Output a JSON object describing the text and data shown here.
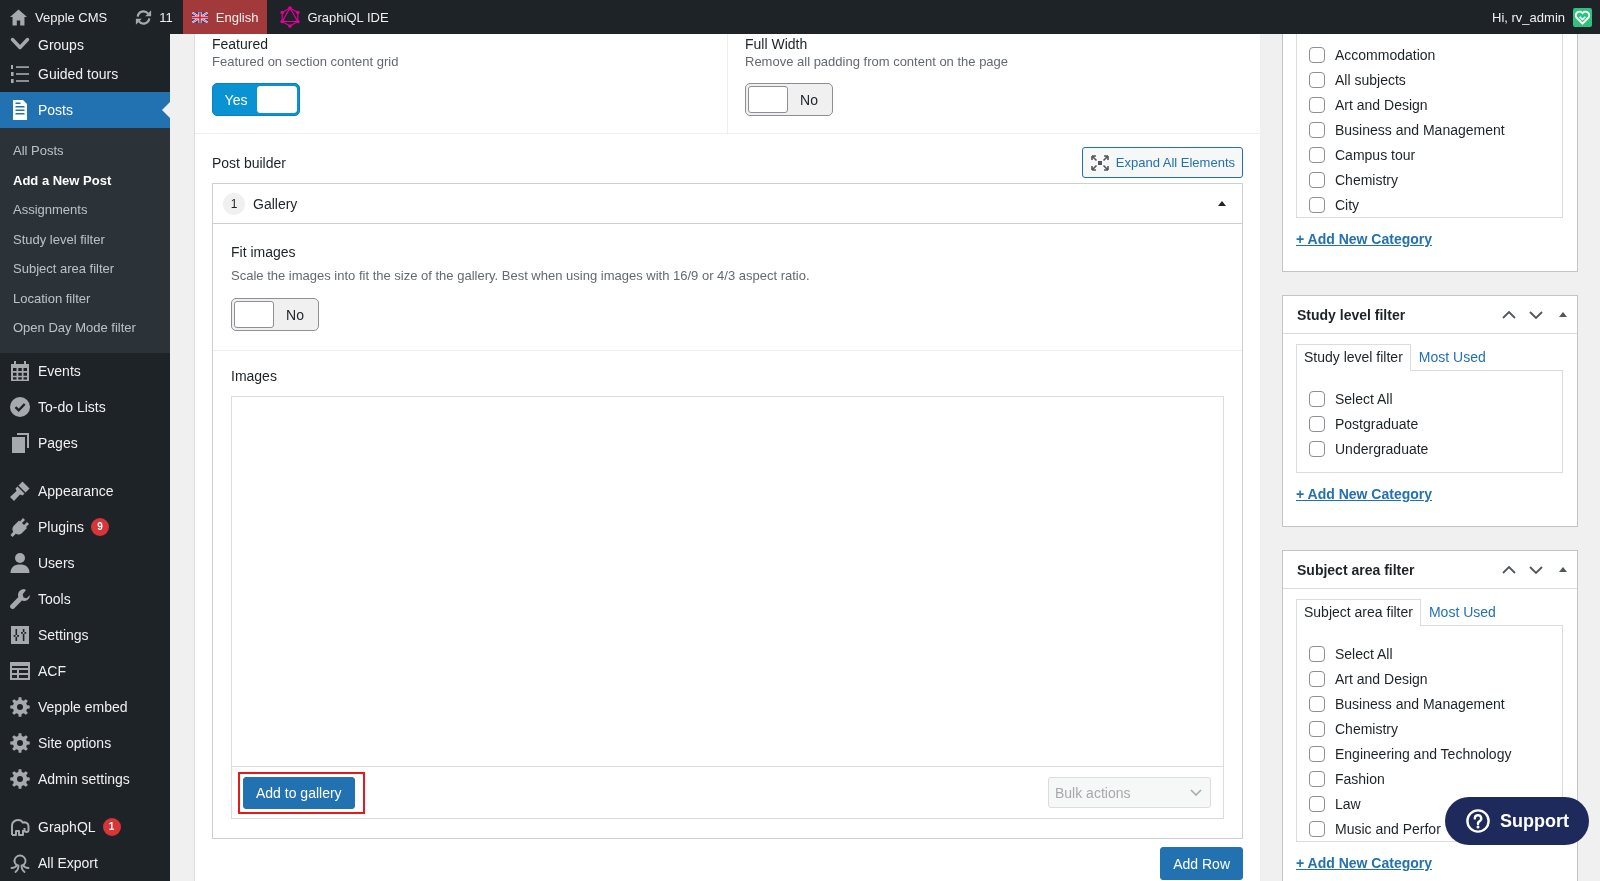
{
  "admin_bar": {
    "items": [
      {
        "label": "Vepple CMS",
        "highlighted": false
      },
      {
        "label": "11",
        "highlighted": false
      },
      {
        "label": "English",
        "highlighted": true
      },
      {
        "label": "GraphiQL IDE",
        "highlighted": false
      }
    ],
    "greeting": "Hi, rv_admin"
  },
  "sidebar": {
    "sections": [
      {
        "items": [
          {
            "label": "Groups",
            "selected": false
          },
          {
            "label": "Guided tours",
            "selected": false
          },
          {
            "label": "Posts",
            "selected": true,
            "children": [
              {
                "label": "All Posts",
                "selected": false
              },
              {
                "label": "Add a New Post",
                "selected": true
              },
              {
                "label": "Assignments",
                "selected": false
              },
              {
                "label": "Study level filter",
                "selected": false
              },
              {
                "label": "Subject area filter",
                "selected": false
              },
              {
                "label": "Location filter",
                "selected": false
              },
              {
                "label": "Open Day Mode filter",
                "selected": false
              }
            ]
          },
          {
            "label": "Events",
            "selected": false
          },
          {
            "label": "To-do Lists",
            "selected": false
          },
          {
            "label": "Pages",
            "selected": false
          }
        ]
      },
      {
        "items": [
          {
            "label": "Appearance",
            "selected": false
          },
          {
            "label": "Plugins",
            "selected": false,
            "badge": "9"
          },
          {
            "label": "Users",
            "selected": false
          },
          {
            "label": "Tools",
            "selected": false
          },
          {
            "label": "Settings",
            "selected": false
          },
          {
            "label": "ACF",
            "selected": false
          },
          {
            "label": "Vepple embed",
            "selected": false
          },
          {
            "label": "Site options",
            "selected": false
          },
          {
            "label": "Admin settings",
            "selected": false
          }
        ]
      },
      {
        "items": [
          {
            "label": "GraphQL",
            "selected": false,
            "badge": "1"
          },
          {
            "label": "All Export",
            "selected": false
          }
        ]
      }
    ]
  },
  "main": {
    "fields": [
      {
        "label": "Featured",
        "description": "Featured on section content grid",
        "toggle": {
          "on": true,
          "text": "Yes"
        }
      },
      {
        "label": "Full Width",
        "description": "Remove all padding from content on the page",
        "toggle": {
          "on": false,
          "text": "No"
        }
      }
    ],
    "post_builder": {
      "label": "Post builder",
      "expand_button": "Expand All Elements",
      "layouts": [
        {
          "number": "1",
          "title": "Gallery",
          "expanded": true,
          "fields": [
            {
              "label": "Fit images",
              "description": "Scale the images into fit the size of the gallery. Best when using images with 16/9 or 4/3 aspect ratio.",
              "toggle": {
                "on": false,
                "text": "No"
              }
            }
          ],
          "images": {
            "label": "Images",
            "add_button": {
              "label": "Add to gallery",
              "highlighted": true
            },
            "bulk_actions": {
              "value": "Bulk actions",
              "disabled": true
            }
          }
        }
      ],
      "add_row": "Add Row"
    }
  },
  "metaboxes": [
    {
      "items": [
        {
          "label": "Accommodation",
          "checked": false
        },
        {
          "label": "All subjects",
          "checked": false
        },
        {
          "label": "Art and Design",
          "checked": false
        },
        {
          "label": "Business and Management",
          "checked": false
        },
        {
          "label": "Campus tour",
          "checked": false
        },
        {
          "label": "Chemistry",
          "checked": false
        },
        {
          "label": "City",
          "checked": false
        }
      ],
      "add_link": "+ Add New Category"
    },
    {
      "title": "Study level filter",
      "tabs": [
        {
          "label": "Study level filter",
          "selected": true
        },
        {
          "label": "Most Used",
          "selected": false
        }
      ],
      "items": [
        {
          "label": "Select All",
          "checked": false
        },
        {
          "label": "Postgraduate",
          "checked": false
        },
        {
          "label": "Undergraduate",
          "checked": false
        }
      ],
      "add_link": "+ Add New Category"
    },
    {
      "title": "Subject area filter",
      "tabs": [
        {
          "label": "Subject area filter",
          "selected": true
        },
        {
          "label": "Most Used",
          "selected": false
        }
      ],
      "items": [
        {
          "label": "Select All",
          "checked": false
        },
        {
          "label": "Art and Design",
          "checked": false
        },
        {
          "label": "Business and Management",
          "checked": false
        },
        {
          "label": "Chemistry",
          "checked": false
        },
        {
          "label": "Engineering and Technology",
          "checked": false
        },
        {
          "label": "Fashion",
          "checked": false
        },
        {
          "label": "Law",
          "checked": false
        },
        {
          "label": "Music and Perfor",
          "checked": false
        }
      ],
      "add_link": "+ Add New Category"
    }
  ],
  "support_button": {
    "label": "Support"
  }
}
